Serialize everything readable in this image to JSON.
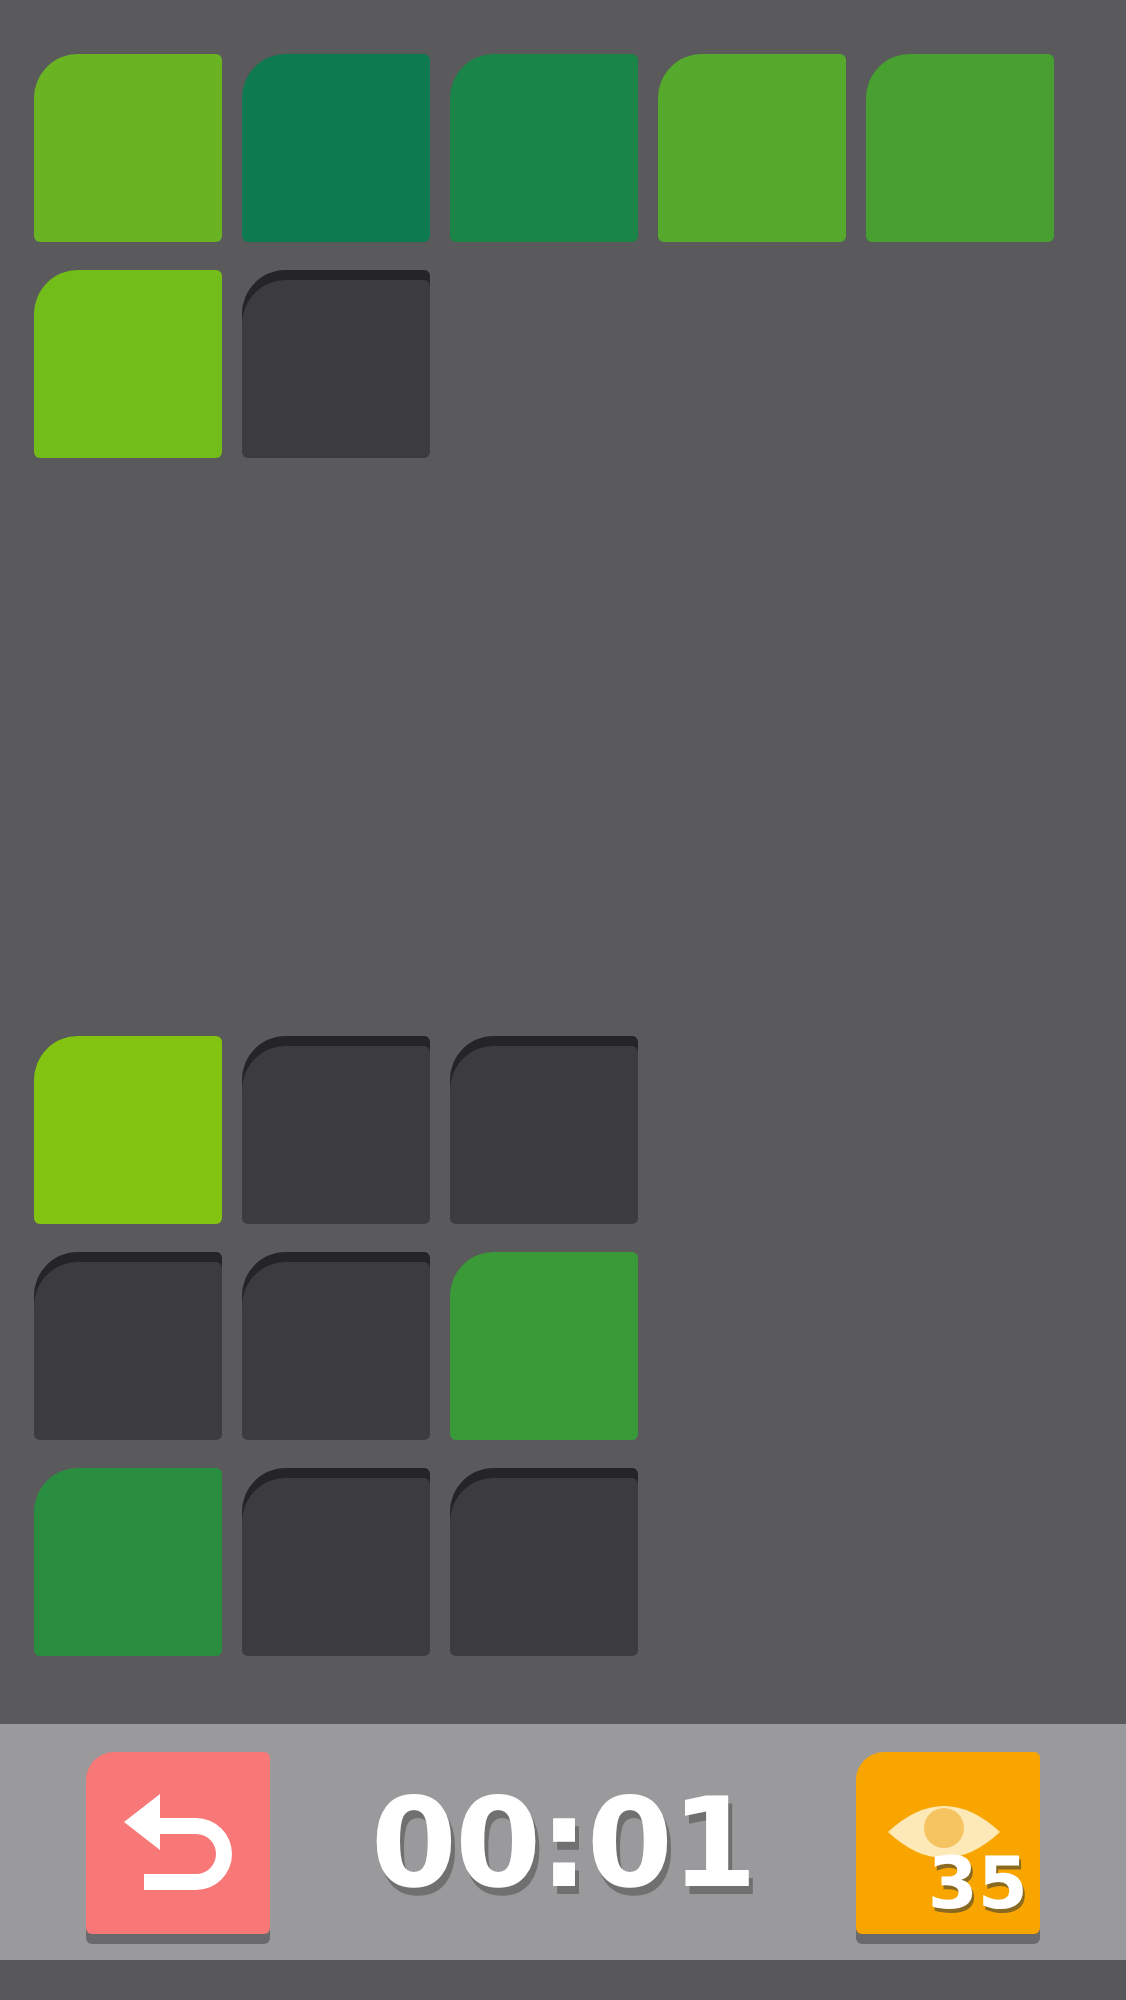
{
  "target_rows": [
    [
      {
        "kind": "tile",
        "color": "#6ab423"
      },
      {
        "kind": "tile",
        "color": "#0e7a50"
      },
      {
        "kind": "tile",
        "color": "#1a8549"
      },
      {
        "kind": "tile",
        "color": "#55aa2d"
      },
      {
        "kind": "tile",
        "color": "#47a030"
      }
    ],
    [
      {
        "kind": "tile",
        "color": "#72bd19"
      },
      {
        "kind": "slot"
      }
    ]
  ],
  "board_rows": [
    [
      {
        "kind": "tile",
        "color": "#82c411"
      },
      {
        "kind": "slot"
      },
      {
        "kind": "slot"
      }
    ],
    [
      {
        "kind": "slot"
      },
      {
        "kind": "slot"
      },
      {
        "kind": "tile",
        "color": "#3a9a38"
      }
    ],
    [
      {
        "kind": "tile",
        "color": "#2a8e40"
      },
      {
        "kind": "slot"
      },
      {
        "kind": "slot"
      }
    ]
  ],
  "toolbar": {
    "timer": "00:01",
    "hint_count": "35"
  }
}
